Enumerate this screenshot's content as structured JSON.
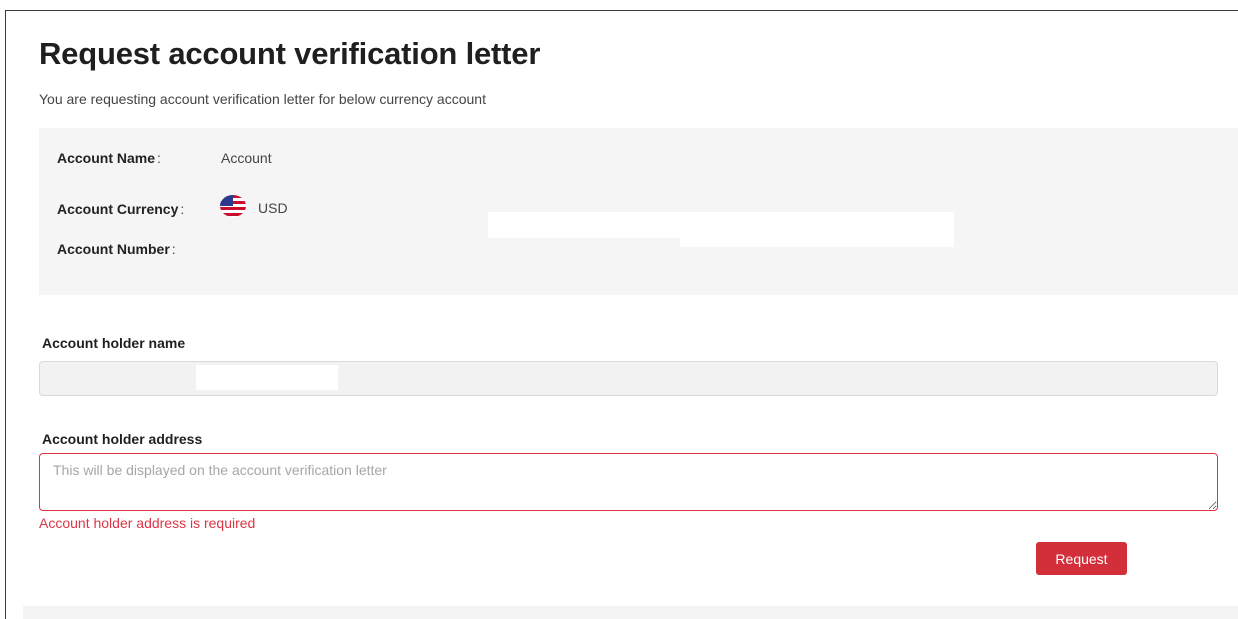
{
  "page": {
    "title": "Request account verification letter",
    "subtitle": "You are requesting account verification letter for below currency account"
  },
  "account": {
    "name_label": "Account Name",
    "name_value": "Account",
    "currency_label": "Account Currency",
    "currency_icon": "us-flag-icon",
    "currency_value": "USD",
    "number_label": "Account Number",
    "colon": ":"
  },
  "form": {
    "holder_name_label": "Account holder name",
    "holder_address_label": "Account holder address",
    "holder_address_placeholder": "This will be displayed on the account verification letter",
    "holder_address_value": "",
    "holder_address_error": "Account holder address is required",
    "request_label": "Request"
  },
  "colors": {
    "accent": "#d32f3a",
    "error": "#dc3545",
    "panel": "#f5f5f5"
  }
}
